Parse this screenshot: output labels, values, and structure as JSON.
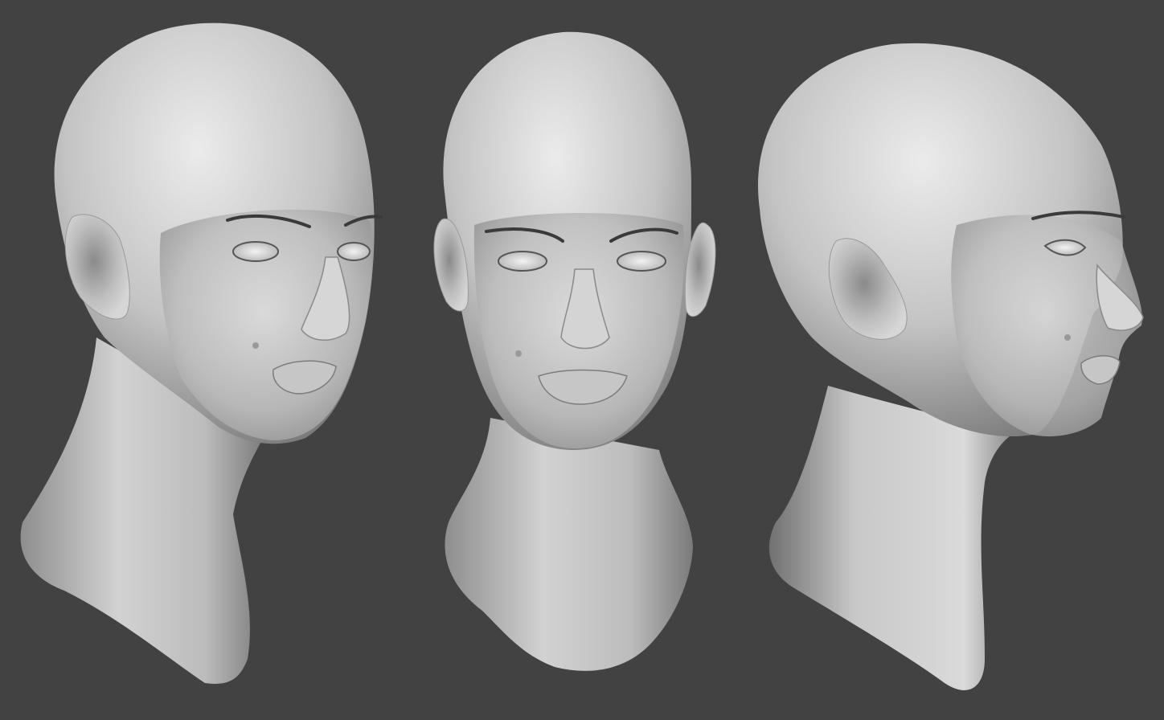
{
  "scene": {
    "background_color": "#424242",
    "clay_color": "#c8c8c8",
    "views": [
      {
        "name": "three-quarter-left"
      },
      {
        "name": "front"
      },
      {
        "name": "profile-right"
      }
    ]
  }
}
